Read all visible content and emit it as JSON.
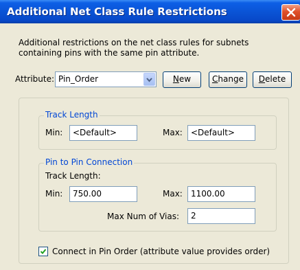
{
  "dialog": {
    "title": "Additional Net Class Rule Restrictions",
    "description": "Additional restrictions on the net class rules for subnets containing pins with the same pin attribute."
  },
  "attribute": {
    "label": "Attribute:",
    "selected": "Pin_Order"
  },
  "buttons": {
    "new": {
      "mnemonic": "N",
      "rest": "ew"
    },
    "change": {
      "mnemonic": "C",
      "rest": "hange"
    },
    "delete": {
      "mnemonic": "D",
      "rest": "elete"
    }
  },
  "track_length": {
    "title": "Track Length",
    "min_label": "Min:",
    "min_value": "<Default>",
    "max_label": "Max:",
    "max_value": "<Default>"
  },
  "pin_to_pin": {
    "title": "Pin to Pin Connection",
    "track_length_label": "Track Length:",
    "min_label": "Min:",
    "min_value": "750.00",
    "max_label": "Max:",
    "max_value": "1100.00",
    "vias_label": "Max Num of Vias:",
    "vias_value": "2"
  },
  "connect_in_pin_order": {
    "checked": true,
    "label": "Connect in Pin Order  (attribute value provides order)"
  },
  "icons": {
    "close": "close-icon",
    "dropdown": "chevron-down-icon",
    "check": "checkmark-icon"
  }
}
